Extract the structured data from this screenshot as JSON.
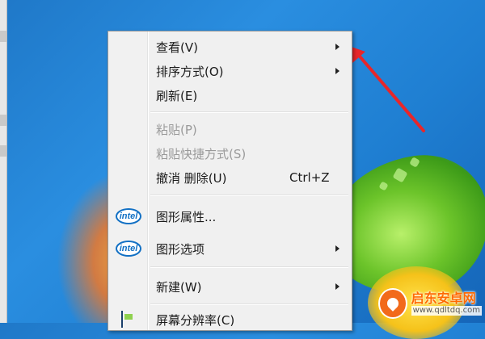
{
  "context_menu": {
    "items": [
      {
        "label": "查看(V)",
        "submenu": true,
        "enabled": true
      },
      {
        "label": "排序方式(O)",
        "submenu": true,
        "enabled": true
      },
      {
        "label": "刷新(E)",
        "submenu": false,
        "enabled": true
      },
      {
        "label": "粘贴(P)",
        "submenu": false,
        "enabled": false
      },
      {
        "label": "粘贴快捷方式(S)",
        "submenu": false,
        "enabled": false
      },
      {
        "label": "撤消 删除(U)",
        "shortcut": "Ctrl+Z",
        "submenu": false,
        "enabled": true
      },
      {
        "label": "图形属性...",
        "icon": "intel-icon",
        "submenu": false,
        "enabled": true
      },
      {
        "label": "图形选项",
        "icon": "intel-icon",
        "submenu": true,
        "enabled": true
      },
      {
        "label": "新建(W)",
        "submenu": true,
        "enabled": true
      },
      {
        "label": "屏幕分辨率(C)",
        "icon": "screen-resolution-icon",
        "submenu": false,
        "enabled": true
      }
    ],
    "intel_icon_text": "intel"
  },
  "watermark": {
    "title": "启东安卓网",
    "url": "www.qdltdq.com"
  },
  "colors": {
    "desktop_blue": "#1f78c8",
    "annotation_arrow": "#e8262a",
    "menu_bg": "#f0f0f0",
    "watermark_orange": "#ff6a00"
  }
}
